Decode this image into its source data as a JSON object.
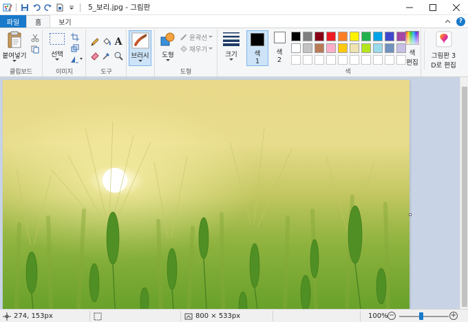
{
  "window": {
    "title": "5_보리.jpg - 그림판"
  },
  "tabs": {
    "file": "파일",
    "home": "홈",
    "view": "보기"
  },
  "ribbon": {
    "clipboard": {
      "paste": "붙여넣기",
      "group": "클립보드"
    },
    "image": {
      "select": "선택",
      "group": "이미지"
    },
    "tools": {
      "group": "도구"
    },
    "brushes": {
      "label": "브러시"
    },
    "shapes": {
      "shapes": "도형",
      "outline": "윤곽선",
      "fill": "채우기",
      "group": "도형"
    },
    "size": {
      "label": "크기"
    },
    "color1": {
      "line1": "색",
      "line2": "1"
    },
    "color2": {
      "line1": "색",
      "line2": "2"
    },
    "colors": {
      "group": "색",
      "edit_line1": "색",
      "edit_line2": "편집",
      "row1": [
        "#000000",
        "#7f7f7f",
        "#880015",
        "#ed1c24",
        "#ff7f27",
        "#fff200",
        "#22b14c",
        "#00a2e8",
        "#3f48cc",
        "#a349a4"
      ],
      "row2": [
        "#ffffff",
        "#c3c3c3",
        "#b97a57",
        "#ffaec9",
        "#ffc90e",
        "#efe4b0",
        "#b5e61d",
        "#99d9ea",
        "#7092be",
        "#c8bfe7"
      ]
    },
    "paint3d": {
      "line1": "그림판 3",
      "line2": "D로 편집"
    }
  },
  "status": {
    "cursor": "274, 153px",
    "dimensions": "800 × 533px",
    "zoom": "100%",
    "zoom_fraction": 0.45
  },
  "colors": {
    "accent": "#1979ca",
    "primary_color": "#000000",
    "secondary_color": "#ffffff"
  }
}
